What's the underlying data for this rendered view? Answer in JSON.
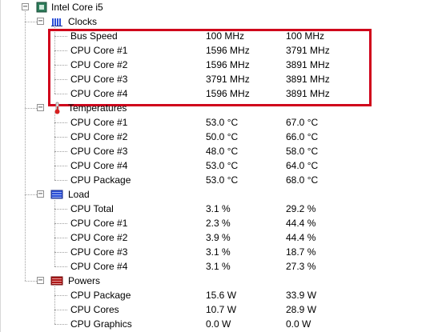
{
  "tree": {
    "root": {
      "label": "Intel Core i5",
      "icon": "cpu-chip-icon"
    },
    "sections": [
      {
        "id": "clocks",
        "label": "Clocks",
        "icon": "clocks-icon",
        "highlighted": true,
        "sensors": [
          {
            "name": "Bus Speed",
            "value": "100 MHz",
            "max": "100 MHz"
          },
          {
            "name": "CPU Core #1",
            "value": "1596 MHz",
            "max": "3791 MHz"
          },
          {
            "name": "CPU Core #2",
            "value": "1596 MHz",
            "max": "3891 MHz"
          },
          {
            "name": "CPU Core #3",
            "value": "3791 MHz",
            "max": "3891 MHz"
          },
          {
            "name": "CPU Core #4",
            "value": "1596 MHz",
            "max": "3891 MHz"
          }
        ]
      },
      {
        "id": "temperatures",
        "label": "Temperatures",
        "icon": "thermometer-icon",
        "sensors": [
          {
            "name": "CPU Core #1",
            "value": "53.0 °C",
            "max": "67.0 °C"
          },
          {
            "name": "CPU Core #2",
            "value": "50.0 °C",
            "max": "66.0 °C"
          },
          {
            "name": "CPU Core #3",
            "value": "48.0 °C",
            "max": "58.0 °C"
          },
          {
            "name": "CPU Core #4",
            "value": "53.0 °C",
            "max": "64.0 °C"
          },
          {
            "name": "CPU Package",
            "value": "53.0 °C",
            "max": "68.0 °C"
          }
        ]
      },
      {
        "id": "load",
        "label": "Load",
        "icon": "load-bars-icon",
        "sensors": [
          {
            "name": "CPU Total",
            "value": "3.1 %",
            "max": "29.2 %"
          },
          {
            "name": "CPU Core #1",
            "value": "2.3 %",
            "max": "44.4 %"
          },
          {
            "name": "CPU Core #2",
            "value": "3.9 %",
            "max": "44.4 %"
          },
          {
            "name": "CPU Core #3",
            "value": "3.1 %",
            "max": "18.7 %"
          },
          {
            "name": "CPU Core #4",
            "value": "3.1 %",
            "max": "27.3 %"
          }
        ]
      },
      {
        "id": "powers",
        "label": "Powers",
        "icon": "power-bars-icon",
        "sensors": [
          {
            "name": "CPU Package",
            "value": "15.6 W",
            "max": "33.9 W"
          },
          {
            "name": "CPU Cores",
            "value": "10.7 W",
            "max": "28.9 W"
          },
          {
            "name": "CPU Graphics",
            "value": "0.0 W",
            "max": "0.0 W"
          }
        ]
      }
    ]
  },
  "colors": {
    "highlight": "#d0021b",
    "text": "#000000",
    "tree_lines": "#a0a0a0",
    "clocks_icon": "#2b4fd8",
    "load_icon": "#2b4fd8",
    "power_icon": "#b01818",
    "temp_icon": "#d62020"
  }
}
